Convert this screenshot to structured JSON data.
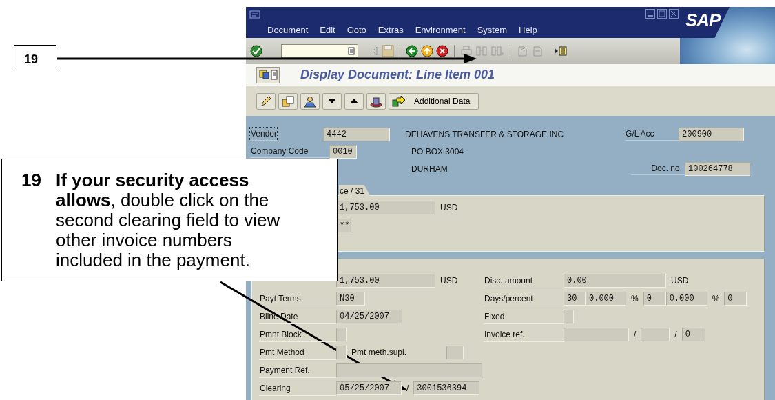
{
  "window": {
    "menu": [
      "Document",
      "Edit",
      "Goto",
      "Extras",
      "Environment",
      "System",
      "Help"
    ],
    "logo": "SAP"
  },
  "title": "Display Document: Line Item 001",
  "app_toolbar": {
    "button": "Additional Data"
  },
  "header": {
    "rows": [
      {
        "label": "Vendor",
        "focused": true,
        "value": "4442",
        "text": "DEHAVENS TRANSFER & STORAGE INC",
        "right_label": "G/L Acc",
        "right_value": "200900"
      },
      {
        "label": "Company Code",
        "focused": false,
        "value": "0010",
        "text": "PO BOX 3004"
      },
      {
        "text": "DURHAM",
        "right_label": "Doc. no.",
        "right_value": "100264778"
      }
    ]
  },
  "tab_panel": {
    "tab": "ce / 31",
    "rows": [
      [
        {
          "kind": "field",
          "text": "1,753.00"
        },
        {
          "kind": "text",
          "text": "USD"
        }
      ],
      [
        {
          "kind": "field",
          "text": "**"
        }
      ]
    ]
  },
  "detail_panel": {
    "rows": [
      {
        "left": [
          {
            "kind": "field",
            "text": "1,753.00"
          },
          {
            "kind": "text",
            "text": "USD"
          }
        ],
        "right": [
          {
            "kind": "label",
            "text": "Disc. amount"
          },
          {
            "kind": "field",
            "text": "0.00"
          },
          {
            "kind": "text",
            "text": "USD"
          }
        ]
      },
      {
        "left": [
          {
            "kind": "label",
            "text": "Payt Terms"
          },
          {
            "kind": "field",
            "text": "N30"
          }
        ],
        "right": [
          {
            "kind": "label",
            "text": "Days/percent"
          },
          {
            "kind": "field",
            "text": "30"
          },
          {
            "kind": "field",
            "text": "0.000"
          },
          {
            "kind": "text",
            "text": "%"
          },
          {
            "kind": "field",
            "text": "0"
          },
          {
            "kind": "field",
            "text": "0.000"
          },
          {
            "kind": "text",
            "text": "%"
          },
          {
            "kind": "field",
            "text": "0"
          }
        ]
      },
      {
        "left": [
          {
            "kind": "label",
            "text": "Bline Date"
          },
          {
            "kind": "field",
            "text": "04/25/2007"
          }
        ],
        "right": [
          {
            "kind": "label",
            "text": "Fixed"
          },
          {
            "kind": "field"
          }
        ]
      },
      {
        "left": [
          {
            "kind": "label",
            "text": "Pmnt Block"
          },
          {
            "kind": "field"
          }
        ],
        "right": [
          {
            "kind": "label",
            "text": "Invoice ref."
          },
          {
            "kind": "field"
          },
          {
            "kind": "text",
            "text": "/"
          },
          {
            "kind": "field"
          },
          {
            "kind": "text",
            "text": "/"
          },
          {
            "kind": "field",
            "text": "0"
          }
        ]
      },
      {
        "left": [
          {
            "kind": "label",
            "text": "Pmt Method"
          },
          {
            "kind": "field"
          },
          {
            "kind": "text",
            "text": "Pmt meth.supl."
          },
          {
            "kind": "field"
          }
        ],
        "right": []
      },
      {
        "left": [
          {
            "kind": "label",
            "text": "Payment Ref."
          },
          {
            "kind": "field"
          }
        ],
        "right": []
      },
      {
        "left": [
          {
            "kind": "label",
            "text": "Clearing"
          },
          {
            "kind": "field",
            "text": "05/25/2007"
          },
          {
            "kind": "text",
            "text": "/"
          },
          {
            "kind": "field",
            "text": "3001536394"
          }
        ],
        "right": []
      }
    ]
  },
  "callouts": [
    {
      "number": "19"
    },
    {
      "number": "19",
      "text": "**If your security access allows**, double click on the second clearing field to view other invoice numbers included in the payment."
    }
  ]
}
